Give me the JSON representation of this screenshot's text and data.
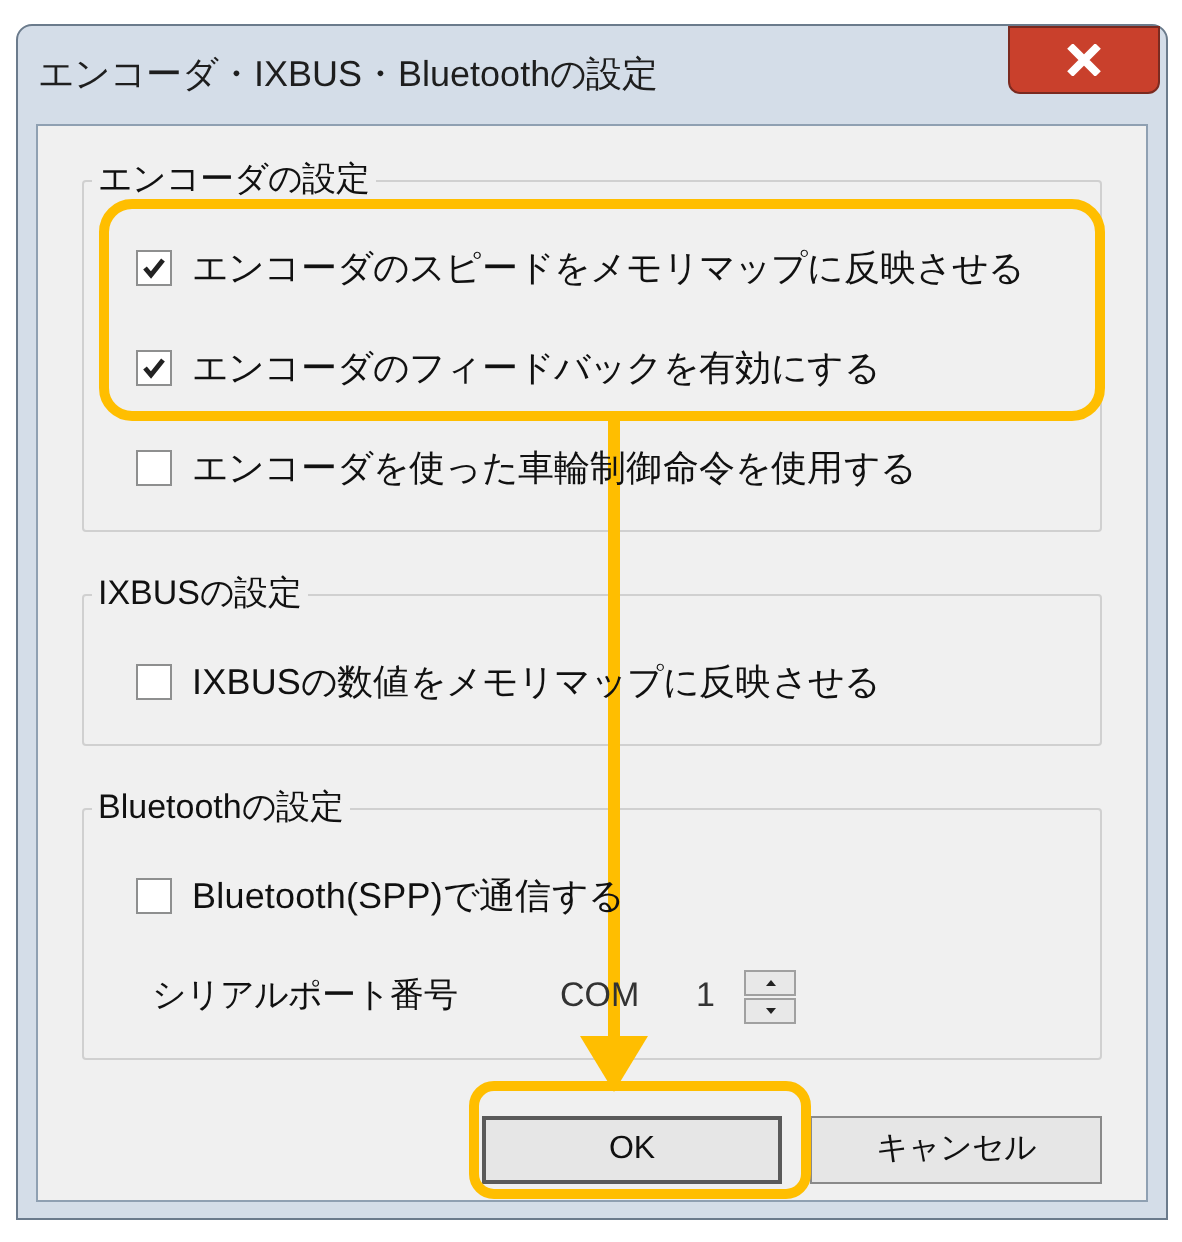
{
  "window": {
    "title": "エンコーダ・IXBUS・Bluetoothの設定"
  },
  "groups": [
    {
      "title": "エンコーダの設定",
      "items": [
        {
          "kind": "checkbox",
          "label": "エンコーダのスピードをメモリマップに反映させる",
          "checked": true
        },
        {
          "kind": "checkbox",
          "label": "エンコーダのフィードバックを有効にする",
          "checked": true
        },
        {
          "kind": "checkbox",
          "label": "エンコーダを使った車輪制御命令を使用する",
          "checked": false
        }
      ]
    },
    {
      "title": "IXBUSの設定",
      "items": [
        {
          "kind": "checkbox",
          "label": "IXBUSの数値をメモリマップに反映させる",
          "checked": false
        }
      ]
    },
    {
      "title": "Bluetoothの設定",
      "items": [
        {
          "kind": "checkbox",
          "label": "Bluetooth(SPP)で通信する",
          "checked": false
        },
        {
          "kind": "spinner",
          "label": "シリアルポート番号",
          "prefix": "COM",
          "value": "1"
        }
      ]
    }
  ],
  "buttons": [
    {
      "label": "OK",
      "default": true
    },
    {
      "label": "キャンセル",
      "default": false
    }
  ]
}
